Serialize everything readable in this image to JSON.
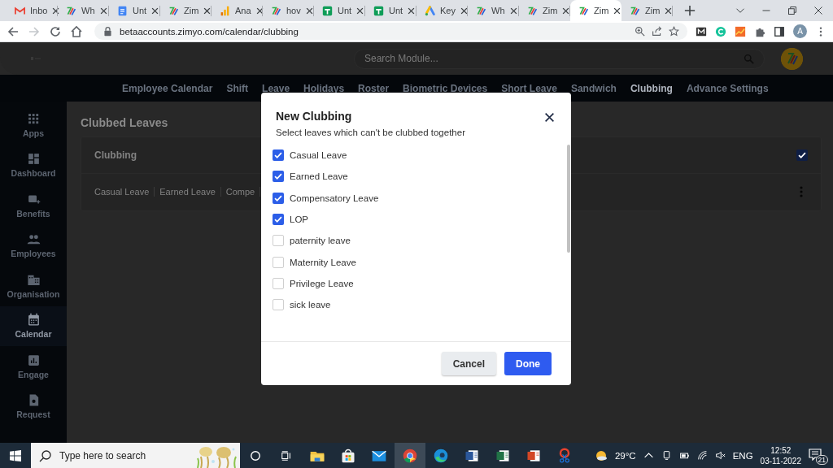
{
  "browser": {
    "tabs": [
      {
        "label": "Inbo",
        "kind": "mail",
        "selected": false
      },
      {
        "label": "Wh",
        "kind": "logo",
        "selected": false
      },
      {
        "label": "Unt",
        "kind": "doc",
        "selected": false
      },
      {
        "label": "Zim",
        "kind": "logo",
        "selected": false
      },
      {
        "label": "Ana",
        "kind": "bars",
        "selected": false
      },
      {
        "label": "hov",
        "kind": "logo",
        "selected": false
      },
      {
        "label": "Unt",
        "kind": "sheet",
        "selected": false
      },
      {
        "label": "Unt",
        "kind": "sheet",
        "selected": false
      },
      {
        "label": "Key",
        "kind": "triangle",
        "selected": false
      },
      {
        "label": "Wh",
        "kind": "logo",
        "selected": false
      },
      {
        "label": "Zim",
        "kind": "logo",
        "selected": false
      },
      {
        "label": "Zim",
        "kind": "logo",
        "selected": true
      },
      {
        "label": "Zim",
        "kind": "logo",
        "selected": false
      }
    ],
    "url": "betaaccounts.zimyo.com/calendar/clubbing",
    "profile": "A"
  },
  "app": {
    "search": {
      "placeholder": "Search Module..."
    },
    "nav": [
      {
        "label": "Employee Calendar",
        "selected": false
      },
      {
        "label": "Shift",
        "selected": false
      },
      {
        "label": "Leave",
        "selected": false
      },
      {
        "label": "Holidays",
        "selected": false
      },
      {
        "label": "Roster",
        "selected": false
      },
      {
        "label": "Biometric Devices",
        "selected": false
      },
      {
        "label": "Short Leave",
        "selected": false
      },
      {
        "label": "Sandwich",
        "selected": false
      },
      {
        "label": "Clubbing",
        "selected": true
      },
      {
        "label": "Advance Settings",
        "selected": false
      }
    ],
    "sidebar": [
      {
        "label": "Apps",
        "kind": "grid",
        "selected": false
      },
      {
        "label": "Dashboard",
        "kind": "dashboard",
        "selected": false
      },
      {
        "label": "Benefits",
        "kind": "benefits",
        "selected": false
      },
      {
        "label": "Employees",
        "kind": "people",
        "selected": false
      },
      {
        "label": "Organisation",
        "kind": "building",
        "selected": false
      },
      {
        "label": "Calendar",
        "kind": "calendar",
        "selected": true
      },
      {
        "label": "Engage",
        "kind": "chart",
        "selected": false
      },
      {
        "label": "Request",
        "kind": "document",
        "selected": false
      }
    ],
    "page_title": "Clubbed Leaves",
    "card": {
      "title": "Clubbing",
      "checked": true,
      "leaves": [
        "Casual Leave",
        "Earned Leave",
        "Compe"
      ]
    }
  },
  "dialog": {
    "title": "New Clubbing",
    "subtitle": "Select leaves which can't be clubbed together",
    "options": [
      {
        "label": "Casual Leave",
        "checked": true
      },
      {
        "label": "Earned Leave",
        "checked": true
      },
      {
        "label": "Compensatory Leave",
        "checked": true
      },
      {
        "label": "LOP",
        "checked": true
      },
      {
        "label": "paternity leave",
        "checked": false
      },
      {
        "label": "Maternity Leave",
        "checked": false
      },
      {
        "label": "Privilege Leave",
        "checked": false
      },
      {
        "label": "sick leave",
        "checked": false
      }
    ],
    "buttons": [
      {
        "label": "Cancel",
        "kind": "secondary"
      },
      {
        "label": "Done",
        "kind": "primary"
      }
    ]
  },
  "taskbar": {
    "search_placeholder": "Type here to search",
    "apps": [
      {
        "kind": "folder",
        "selected": false
      },
      {
        "kind": "store",
        "selected": false
      },
      {
        "kind": "mail",
        "selected": false
      },
      {
        "kind": "browser",
        "selected": true
      },
      {
        "kind": "edge",
        "selected": false
      },
      {
        "kind": "word",
        "selected": false
      },
      {
        "kind": "excel",
        "selected": false
      },
      {
        "kind": "slides",
        "selected": false
      },
      {
        "kind": "snip",
        "selected": false
      }
    ],
    "weather": "29°C",
    "language": "ENG",
    "time": "12:52",
    "date": "03-11-2022",
    "notifications": "21"
  }
}
